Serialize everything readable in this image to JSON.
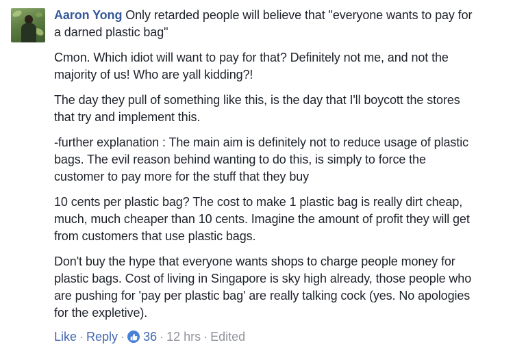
{
  "comment": {
    "author": "Aaron Yong",
    "paragraphs": [
      {
        "lines": [
          "Only retarded people will believe that \"everyone wants to pay for",
          "a darned plastic bag\""
        ]
      },
      {
        "lines": [
          "Cmon. Which idiot will want to pay for that? Definitely not me, and not the",
          "majority of us! Who are yall kidding?!"
        ]
      },
      {
        "lines": [
          "The day they pull of something like this, is the day that I'll boycott the stores",
          "that try and implement this."
        ]
      },
      {
        "lines": [
          "-further explanation : The main aim is definitely not to reduce usage of plastic",
          "bags. The evil reason behind wanting to do this, is simply to force the",
          "customer to pay more for the stuff that they buy"
        ]
      },
      {
        "lines": [
          "10 cents per plastic bag? The cost to make 1 plastic bag is really dirt cheap,",
          "much, much cheaper than 10 cents. Imagine the amount of profit they will get",
          "from customers that use plastic bags."
        ]
      },
      {
        "lines": [
          "Don't buy the hype that everyone wants shops to charge people money for",
          "plastic bags. Cost of living in Singapore is sky high already, those people who",
          "are pushing for 'pay per plastic bag' are really talking cock (yes. No apologies",
          "for the expletive)."
        ]
      }
    ]
  },
  "actions": {
    "like_label": "Like",
    "reply_label": "Reply",
    "separator": "·",
    "reaction_count": "36",
    "reaction_icon": "thumbs-up-icon",
    "timestamp": "12 hrs",
    "edited_label": "Edited"
  },
  "colors": {
    "link_blue": "#4267b2",
    "author_blue": "#365899",
    "meta_grey": "#90949c",
    "text": "#1d2129",
    "like_badge": "#4a7fd8"
  }
}
